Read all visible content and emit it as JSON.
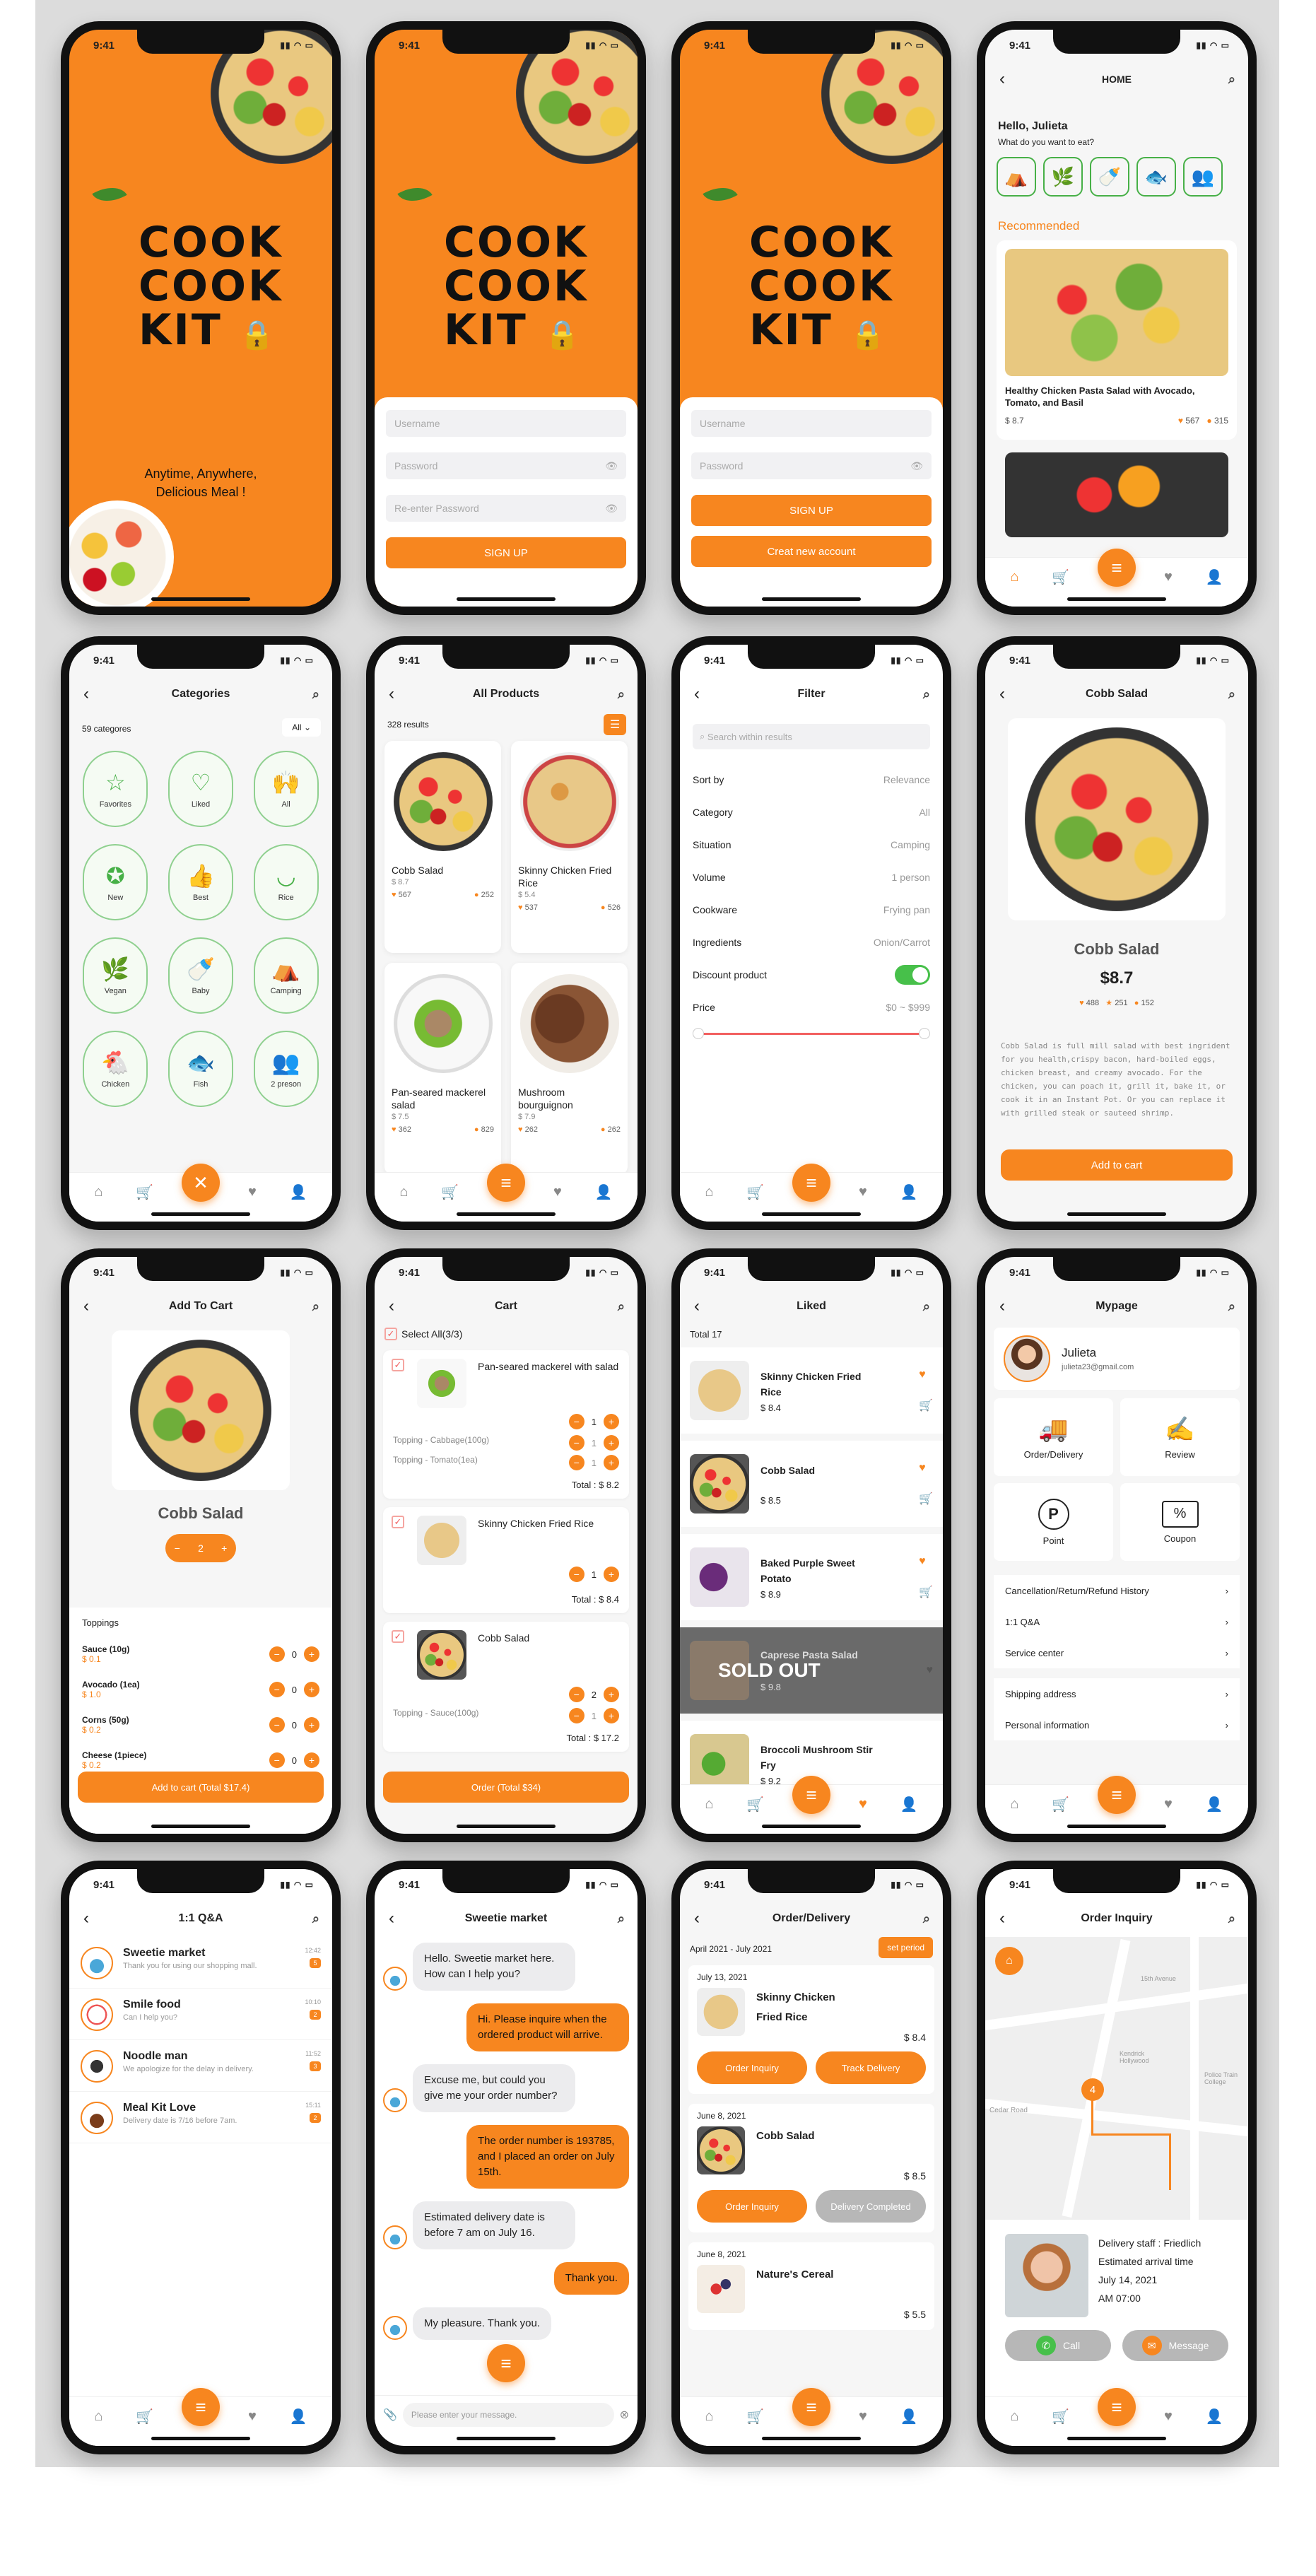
{
  "status_time": "9:41",
  "splash": {
    "brand": [
      "COOK",
      "COOK",
      "KIT"
    ],
    "tagline_1": "Anytime, Anywhere,",
    "tagline_2": "Delicious Meal !"
  },
  "signup": {
    "username": "Username",
    "password": "Password",
    "reenter": "Re-enter Password",
    "signup": "SIGN UP",
    "create": "Creat new account"
  },
  "home": {
    "title": "HOME",
    "greeting": "Hello, Julieta",
    "question": "What do you want to eat?",
    "recommended": "Recommended",
    "card_title": "Healthy Chicken Pasta Salad with Avocado, Tomato, and Basil",
    "card_price": "$ 8.7",
    "card_likes": "567",
    "card_views": "315"
  },
  "categories": {
    "title": "Categories",
    "count": "59 categores",
    "filter": "All",
    "items": [
      "Favorites",
      "Liked",
      "All",
      "New",
      "Best",
      "Rice",
      "Vegan",
      "Baby",
      "Camping",
      "Chicken",
      "Fish",
      "2 preson"
    ]
  },
  "products": {
    "title": "All Products",
    "results": "328 results",
    "items": [
      {
        "name": "Cobb Salad",
        "price": "$ 8.7",
        "likes": "567",
        "views": "252"
      },
      {
        "name": "Skinny Chicken Fried Rice",
        "price": "$ 5.4",
        "likes": "537",
        "views": "526"
      },
      {
        "name": "Pan-seared mackerel salad",
        "price": "$ 7.5",
        "likes": "362",
        "views": "829"
      },
      {
        "name": "Mushroom bourguignon",
        "price": "$ 7.9",
        "likes": "262",
        "views": "262"
      }
    ]
  },
  "filter": {
    "title": "Filter",
    "search": "Search within results",
    "rows": [
      [
        "Sort by",
        "Relevance"
      ],
      [
        "Category",
        "All"
      ],
      [
        "Situation",
        "Camping"
      ],
      [
        "Volume",
        "1 person"
      ],
      [
        "Cookware",
        "Frying pan"
      ],
      [
        "Ingredients",
        "Onion/Carrot"
      ]
    ],
    "discount": "Discount product",
    "price": "Price",
    "price_range": "$0 ~ $999"
  },
  "detail": {
    "title": "Cobb Salad",
    "name": "Cobb Salad",
    "price": "$8.7",
    "likes": "488",
    "stars": "251",
    "views": "152",
    "desc": "Cobb Salad is full mill salad with best ingrident for you health,crispy bacon, hard-boiled eggs, chicken breast, and creamy avocado. For the chicken, you can poach it, grill it, bake it, or cook it in an Instant Pot. Or you can replace it with grilled steak or sauteed shrimp.",
    "cta": "Add to cart"
  },
  "addcart": {
    "title": "Add To Cart",
    "name": "Cobb Salad",
    "qty": "2",
    "toppings_label": "Toppings",
    "toppings": [
      {
        "name": "Sauce (10g)",
        "price": "$ 0.1",
        "qty": "0"
      },
      {
        "name": "Avocado (1ea)",
        "price": "$ 1.0",
        "qty": "0"
      },
      {
        "name": "Corns (50g)",
        "price": "$ 0.2",
        "qty": "0"
      },
      {
        "name": "Cheese (1piece)",
        "price": "$ 0.2",
        "qty": "0"
      }
    ],
    "cta": "Add to cart (Total $17.4)"
  },
  "cart": {
    "title": "Cart",
    "select_all": "Select All(3/3)",
    "items": [
      {
        "name": "Pan-seared mackerel with salad",
        "opts": [
          [
            "Topping - Cabbage(100g)",
            "1"
          ],
          [
            "Topping - Tomato(1ea)",
            "1"
          ]
        ],
        "qty": "1",
        "total": "Total : $ 8.2"
      },
      {
        "name": "Skinny Chicken Fried Rice",
        "opts": [],
        "qty": "1",
        "total": "Total : $ 8.4"
      },
      {
        "name": "Cobb Salad",
        "opts": [
          [
            "Topping - Sauce(100g)",
            "1"
          ]
        ],
        "qty": "2",
        "total": "Total : $ 17.2"
      }
    ],
    "cta": "Order (Total $34)"
  },
  "liked": {
    "title": "Liked",
    "total": "Total 17",
    "items": [
      {
        "name": "Skinny Chicken Fried Rice",
        "price": "$ 8.4"
      },
      {
        "name": "Cobb Salad",
        "price": "$ 8.5"
      },
      {
        "name": "Baked Purple Sweet Potato",
        "price": "$ 8.9"
      },
      {
        "name": "Caprese Pasta Salad",
        "price": "$ 9.8",
        "soldout": "SOLD OUT"
      },
      {
        "name": "Broccoli Mushroom Stir Fry",
        "price": "$ 9.2"
      }
    ]
  },
  "mypage": {
    "title": "Mypage",
    "name": "Julieta",
    "email": "julieta23@gmail.com",
    "boxes": [
      "Order/Delivery",
      "Review",
      "Point",
      "Coupon"
    ],
    "menu": [
      "Cancellation/Return/Refund History",
      "1:1 Q&A",
      "Service center",
      "Shipping address",
      "Personal information"
    ]
  },
  "qa": {
    "title": "1:1 Q&A",
    "rows": [
      {
        "name": "Sweetie market",
        "msg": "Thank you for using our shopping mall.",
        "time": "12:42",
        "count": "5"
      },
      {
        "name": "Smile food",
        "msg": "Can I help you?",
        "time": "10:10",
        "count": "2"
      },
      {
        "name": "Noodle man",
        "msg": "We apologize for the delay in delivery.",
        "time": "11:52",
        "count": "3"
      },
      {
        "name": "Meal Kit Love",
        "msg": "Delivery date is 7/16 before 7am.",
        "time": "15:11",
        "count": "2"
      }
    ]
  },
  "chat": {
    "title": "Sweetie market",
    "messages": [
      {
        "side": "l",
        "text": "Hello. Sweetie market here. How can I help you?"
      },
      {
        "side": "r",
        "text": "Hi. Please inquire when the ordered product will arrive."
      },
      {
        "side": "l",
        "text": "Excuse me, but could you give me your order number?"
      },
      {
        "side": "r",
        "text": "The order number is 193785, and I placed an order on July 15th."
      },
      {
        "side": "l",
        "text": "Estimated delivery date is before 7 am on July 16."
      },
      {
        "side": "r",
        "text": "Thank you."
      },
      {
        "side": "l",
        "text": "My pleasure. Thank you."
      }
    ],
    "placeholder": "Please enter your message."
  },
  "orders": {
    "title": "Order/Delivery",
    "period": "April 2021 - July 2021",
    "period_btn": "set period",
    "items": [
      {
        "date": "July 13, 2021",
        "name": "Skinny Chicken Fried Rice",
        "price": "$ 8.4",
        "b1": "Order Inquiry",
        "b2": "Track Delivery"
      },
      {
        "date": "June 8, 2021",
        "name": "Cobb Salad",
        "price": "$ 8.5",
        "b1": "Order Inquiry",
        "b2": "Delivery Completed"
      },
      {
        "date": "June 8, 2021",
        "name": "Nature's Cereal",
        "price": "$ 5.5"
      }
    ]
  },
  "inquiry": {
    "title": "Order Inquiry",
    "road1": "15th Avenue",
    "road2": "Kendrick Hollywood",
    "road3": "Police Train College",
    "road4": "Cedar Road",
    "pin": "4",
    "staff": "Delivery staff : Friedlich",
    "eta_label": "Estimated arrival time",
    "eta_date": "July 14, 2021",
    "eta_time": "AM 07:00",
    "call": "Call",
    "message": "Message"
  }
}
